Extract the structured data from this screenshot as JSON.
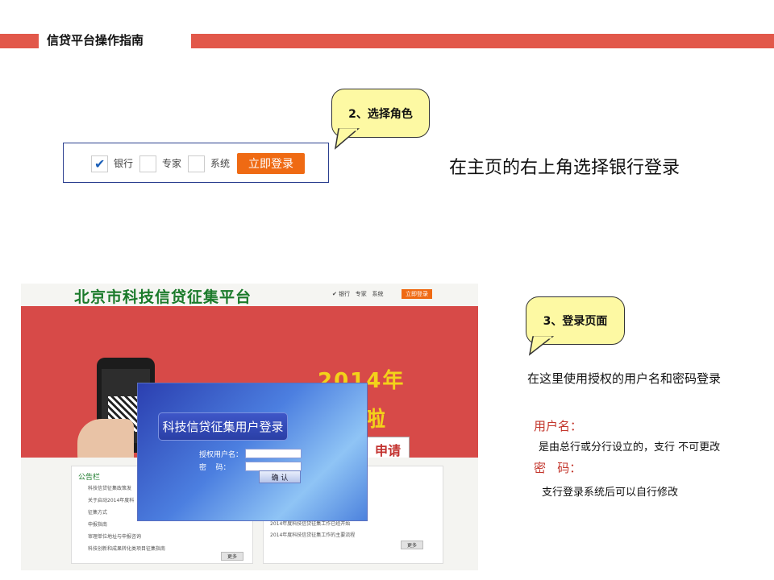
{
  "header": {
    "title": "信贷平台操作指南"
  },
  "callout_role": {
    "text": "2、选择角色"
  },
  "role_selector": {
    "options": [
      {
        "label": "银行",
        "checked": true
      },
      {
        "label": "专家",
        "checked": false
      },
      {
        "label": "系统",
        "checked": false
      }
    ],
    "login_button": "立即登录"
  },
  "role_desc": "在主页的右上角选择银行登录",
  "callout_login": {
    "text": "3、登录页面"
  },
  "screenshot": {
    "site_title": "北京市科技信贷征集平台",
    "roles": [
      "银行",
      "专家",
      "系统"
    ],
    "login_button": "立即登录",
    "banner_year": "2014年",
    "banner_tail": "啦",
    "apply_button": "申请",
    "notice_tag": "公告栏",
    "notice_lines": [
      "科技信贷征集政策发",
      "关于启动2014年度科",
      "征集方式",
      "申报指南",
      "审理单位地址与申报咨询",
      "科技创新和成果转化类项目征集指南"
    ],
    "right_lines": [
      "2014年度科技信贷征集工作已经开始",
      "2014年度科技信贷征集工作的主要流程"
    ],
    "more": "更多",
    "dialog": {
      "title": "科技信贷征集用户登录",
      "username_label": "授权用户名：",
      "password_label": "密    码：",
      "confirm_button": "确 认"
    }
  },
  "login_desc": "在这里使用授权的用户名和密码登录",
  "username": {
    "label": "用户名：",
    "desc": "是由总行或分行设立的，支行 不可更改"
  },
  "password": {
    "label": "密   码：",
    "desc": "支行登录系统后可以自行修改"
  },
  "colors": {
    "accent_red": "#e2584a",
    "button_orange": "#ef6a13",
    "callout_yellow": "#fdf9a3"
  }
}
